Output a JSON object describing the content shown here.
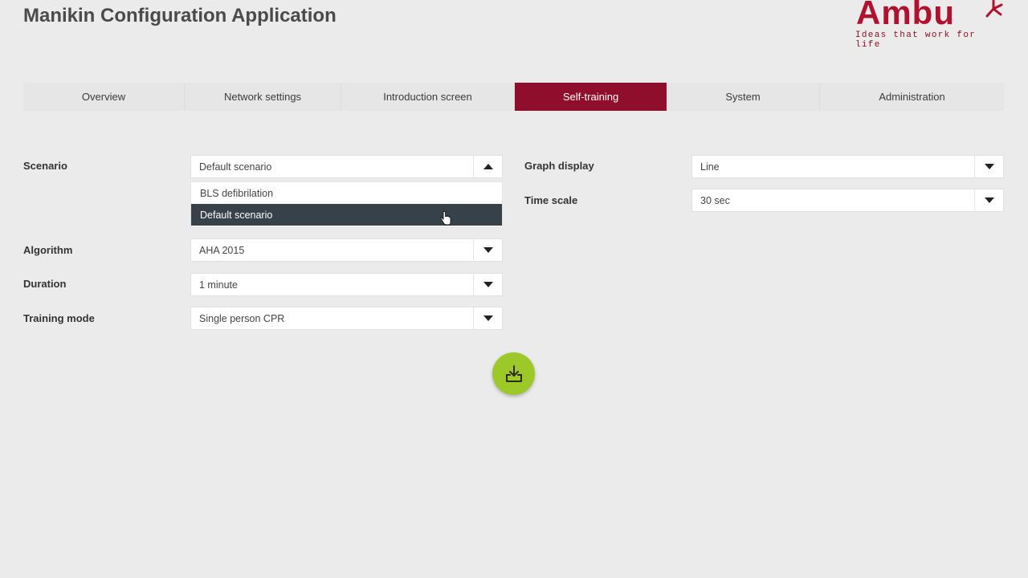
{
  "header": {
    "title": "Manikin Configuration Application",
    "logo_text": "Ambu",
    "logo_tagline": "Ideas that work for life",
    "brand_color": "#b0112f"
  },
  "tabs": [
    {
      "label": "Overview",
      "active": false
    },
    {
      "label": "Network settings",
      "active": false
    },
    {
      "label": "Introduction screen",
      "active": false
    },
    {
      "label": "Self-training",
      "active": true
    },
    {
      "label": "System",
      "active": false
    },
    {
      "label": "Administration",
      "active": false
    }
  ],
  "active_tab_color": "#8f0e2c",
  "left_fields": {
    "scenario": {
      "label": "Scenario",
      "value": "Default scenario",
      "expanded": true,
      "options": [
        {
          "label": "BLS defibrilation",
          "selected": false
        },
        {
          "label": "Default scenario",
          "selected": true
        }
      ]
    },
    "algorithm": {
      "label": "Algorithm",
      "value": "AHA 2015"
    },
    "duration": {
      "label": "Duration",
      "value": "1 minute"
    },
    "training_mode": {
      "label": "Training mode",
      "value": "Single person CPR"
    }
  },
  "right_fields": {
    "graph_display": {
      "label": "Graph display",
      "value": "Line"
    },
    "time_scale": {
      "label": "Time scale",
      "value": "30 sec"
    }
  },
  "save_button": {
    "icon": "download-tray-icon",
    "color": "#9cc828"
  }
}
